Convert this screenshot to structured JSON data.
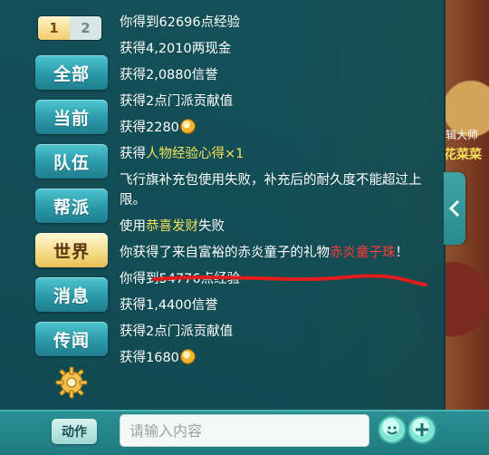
{
  "tabs_numbers": [
    "1",
    "2"
  ],
  "sidebar": {
    "items": [
      {
        "label": "全部"
      },
      {
        "label": "当前"
      },
      {
        "label": "队伍"
      },
      {
        "label": "帮派"
      },
      {
        "label": "世界"
      },
      {
        "label": "消息"
      },
      {
        "label": "传闻"
      }
    ],
    "active_index": 4
  },
  "background_labels": {
    "line1": "辑大师",
    "line2": "花菜菜"
  },
  "messages": [
    {
      "parts": [
        {
          "t": "你得到62696点经验"
        }
      ]
    },
    {
      "parts": [
        {
          "t": "获得4,2010两现金"
        }
      ]
    },
    {
      "parts": [
        {
          "t": "获得2,0880信誉"
        }
      ]
    },
    {
      "parts": [
        {
          "t": "获得2点门派贡献值"
        }
      ]
    },
    {
      "parts": [
        {
          "t": "获得2280"
        }
      ],
      "coin": true
    },
    {
      "parts": [
        {
          "t": "获得"
        },
        {
          "t": "人物经验心得×1",
          "c": "yellow"
        }
      ]
    },
    {
      "parts": [
        {
          "t": "飞行旗补充包使用失败，补充后的耐久度不能超过上限。"
        }
      ]
    },
    {
      "parts": [
        {
          "t": "使用"
        },
        {
          "t": "恭喜发财",
          "c": "yellow"
        },
        {
          "t": "失败"
        }
      ]
    },
    {
      "parts": [
        {
          "t": "你获得了来自富裕的赤炎童子的礼物"
        },
        {
          "t": "赤炎童子珠",
          "c": "red"
        },
        {
          "t": "！"
        }
      ]
    },
    {
      "parts": [
        {
          "t": "你得到54776点经验"
        }
      ]
    },
    {
      "parts": [
        {
          "t": "获得1,4400信誉"
        }
      ]
    },
    {
      "parts": [
        {
          "t": "获得2点门派贡献值"
        }
      ]
    },
    {
      "parts": [
        {
          "t": "获得1680"
        }
      ],
      "coin": true
    }
  ],
  "bottom": {
    "action_label": "动作",
    "input_placeholder": "请输入内容"
  },
  "colors": {
    "highlight_yellow": "#f2e25a",
    "highlight_red": "#ff3b3b",
    "panel_bg": "#134e56",
    "active_tab": "#f6dd8c"
  }
}
